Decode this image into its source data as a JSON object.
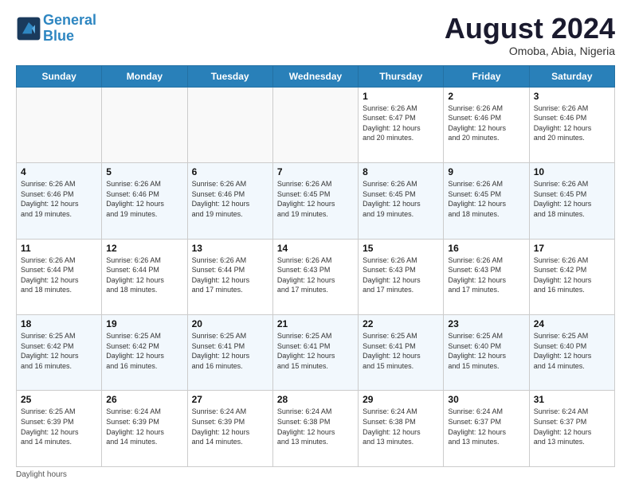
{
  "header": {
    "logo_line1": "General",
    "logo_line2": "Blue",
    "month_title": "August 2024",
    "location": "Omoba, Abia, Nigeria"
  },
  "days_of_week": [
    "Sunday",
    "Monday",
    "Tuesday",
    "Wednesday",
    "Thursday",
    "Friday",
    "Saturday"
  ],
  "weeks": [
    [
      {
        "day": "",
        "info": ""
      },
      {
        "day": "",
        "info": ""
      },
      {
        "day": "",
        "info": ""
      },
      {
        "day": "",
        "info": ""
      },
      {
        "day": "1",
        "info": "Sunrise: 6:26 AM\nSunset: 6:47 PM\nDaylight: 12 hours\nand 20 minutes."
      },
      {
        "day": "2",
        "info": "Sunrise: 6:26 AM\nSunset: 6:46 PM\nDaylight: 12 hours\nand 20 minutes."
      },
      {
        "day": "3",
        "info": "Sunrise: 6:26 AM\nSunset: 6:46 PM\nDaylight: 12 hours\nand 20 minutes."
      }
    ],
    [
      {
        "day": "4",
        "info": "Sunrise: 6:26 AM\nSunset: 6:46 PM\nDaylight: 12 hours\nand 19 minutes."
      },
      {
        "day": "5",
        "info": "Sunrise: 6:26 AM\nSunset: 6:46 PM\nDaylight: 12 hours\nand 19 minutes."
      },
      {
        "day": "6",
        "info": "Sunrise: 6:26 AM\nSunset: 6:46 PM\nDaylight: 12 hours\nand 19 minutes."
      },
      {
        "day": "7",
        "info": "Sunrise: 6:26 AM\nSunset: 6:45 PM\nDaylight: 12 hours\nand 19 minutes."
      },
      {
        "day": "8",
        "info": "Sunrise: 6:26 AM\nSunset: 6:45 PM\nDaylight: 12 hours\nand 19 minutes."
      },
      {
        "day": "9",
        "info": "Sunrise: 6:26 AM\nSunset: 6:45 PM\nDaylight: 12 hours\nand 18 minutes."
      },
      {
        "day": "10",
        "info": "Sunrise: 6:26 AM\nSunset: 6:45 PM\nDaylight: 12 hours\nand 18 minutes."
      }
    ],
    [
      {
        "day": "11",
        "info": "Sunrise: 6:26 AM\nSunset: 6:44 PM\nDaylight: 12 hours\nand 18 minutes."
      },
      {
        "day": "12",
        "info": "Sunrise: 6:26 AM\nSunset: 6:44 PM\nDaylight: 12 hours\nand 18 minutes."
      },
      {
        "day": "13",
        "info": "Sunrise: 6:26 AM\nSunset: 6:44 PM\nDaylight: 12 hours\nand 17 minutes."
      },
      {
        "day": "14",
        "info": "Sunrise: 6:26 AM\nSunset: 6:43 PM\nDaylight: 12 hours\nand 17 minutes."
      },
      {
        "day": "15",
        "info": "Sunrise: 6:26 AM\nSunset: 6:43 PM\nDaylight: 12 hours\nand 17 minutes."
      },
      {
        "day": "16",
        "info": "Sunrise: 6:26 AM\nSunset: 6:43 PM\nDaylight: 12 hours\nand 17 minutes."
      },
      {
        "day": "17",
        "info": "Sunrise: 6:26 AM\nSunset: 6:42 PM\nDaylight: 12 hours\nand 16 minutes."
      }
    ],
    [
      {
        "day": "18",
        "info": "Sunrise: 6:25 AM\nSunset: 6:42 PM\nDaylight: 12 hours\nand 16 minutes."
      },
      {
        "day": "19",
        "info": "Sunrise: 6:25 AM\nSunset: 6:42 PM\nDaylight: 12 hours\nand 16 minutes."
      },
      {
        "day": "20",
        "info": "Sunrise: 6:25 AM\nSunset: 6:41 PM\nDaylight: 12 hours\nand 16 minutes."
      },
      {
        "day": "21",
        "info": "Sunrise: 6:25 AM\nSunset: 6:41 PM\nDaylight: 12 hours\nand 15 minutes."
      },
      {
        "day": "22",
        "info": "Sunrise: 6:25 AM\nSunset: 6:41 PM\nDaylight: 12 hours\nand 15 minutes."
      },
      {
        "day": "23",
        "info": "Sunrise: 6:25 AM\nSunset: 6:40 PM\nDaylight: 12 hours\nand 15 minutes."
      },
      {
        "day": "24",
        "info": "Sunrise: 6:25 AM\nSunset: 6:40 PM\nDaylight: 12 hours\nand 14 minutes."
      }
    ],
    [
      {
        "day": "25",
        "info": "Sunrise: 6:25 AM\nSunset: 6:39 PM\nDaylight: 12 hours\nand 14 minutes."
      },
      {
        "day": "26",
        "info": "Sunrise: 6:24 AM\nSunset: 6:39 PM\nDaylight: 12 hours\nand 14 minutes."
      },
      {
        "day": "27",
        "info": "Sunrise: 6:24 AM\nSunset: 6:39 PM\nDaylight: 12 hours\nand 14 minutes."
      },
      {
        "day": "28",
        "info": "Sunrise: 6:24 AM\nSunset: 6:38 PM\nDaylight: 12 hours\nand 13 minutes."
      },
      {
        "day": "29",
        "info": "Sunrise: 6:24 AM\nSunset: 6:38 PM\nDaylight: 12 hours\nand 13 minutes."
      },
      {
        "day": "30",
        "info": "Sunrise: 6:24 AM\nSunset: 6:37 PM\nDaylight: 12 hours\nand 13 minutes."
      },
      {
        "day": "31",
        "info": "Sunrise: 6:24 AM\nSunset: 6:37 PM\nDaylight: 12 hours\nand 13 minutes."
      }
    ]
  ],
  "footer": {
    "note": "Daylight hours"
  }
}
